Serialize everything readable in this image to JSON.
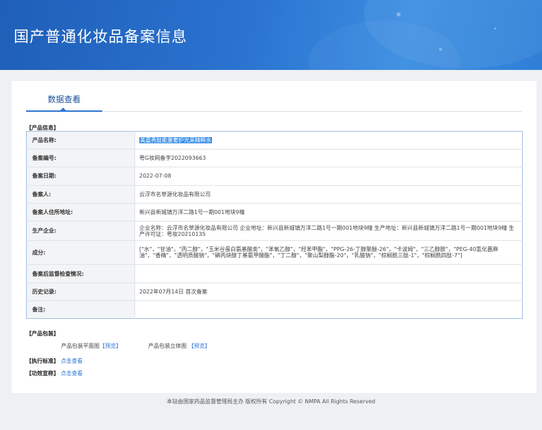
{
  "header": {
    "title": "国产普通化妆品备案信息"
  },
  "tabs": [
    {
      "label": "数据查看"
    }
  ],
  "product_info": {
    "section_label": "【产品信息】",
    "rows": [
      {
        "key": "产品名称:",
        "value": "美嘉秀肽能量奢护光采精粹水",
        "highlight": true
      },
      {
        "key": "备案编号:",
        "value": "粤G妆网备字2022093663"
      },
      {
        "key": "备案日期:",
        "value": "2022-07-08"
      },
      {
        "key": "备案人:",
        "value": "云浮市名草源化妆品有限公司"
      },
      {
        "key": "备案人住所地址:",
        "value": "新兴县新城镇万洋二路1号一期001地块9幢"
      },
      {
        "key": "生产企业:",
        "value": "企业名称：云浮市名草源化妆品有限公司 企业地址：新兴县新城镇万洋二路1号一期001地块9幢 生产地址：新兴县新城镇万洋二路1号一期001地块9幢 生产许可证：粤妆20210135"
      },
      {
        "key": "成分:",
        "value": "[\"水\"，\"甘油\"，\"丙二醇\"，\"玉米谷蛋白氨基酸类\"，\"苯氧乙醇\"，\"羟苯甲酯\"，\"PPG-26-丁醇聚醚-26\"，\"卡波姆\"，\"三乙醇胺\"，\"PEG-40氢化蓖麻油\"，\"香精\"，\"透明质酸钠\"，\"碘丙炔醇丁基氨甲酸酯\"，\"丁二醇\"，\"聚山梨醇酯-20\"，\"乳酸钠\"，\"棕榈酰三肽-1\"，\"棕榈酰四肽-7\"]"
      },
      {
        "key": "备案后监督检查情况:",
        "value": ""
      },
      {
        "key": "历史记录:",
        "value": "2022年07月14日 首次备案"
      },
      {
        "key": "备注:",
        "value": ""
      }
    ]
  },
  "packaging": {
    "section_label": "【产品包装】",
    "flat_label": "产品包装平面图",
    "flat_preview": "【预览】",
    "stereo_label": "产品包装立体图",
    "stereo_preview": "【预览】"
  },
  "standard": {
    "label": "【执行标准】",
    "link": "点击查看"
  },
  "efficacy": {
    "label": "【功效宣称】",
    "link": "点击查看"
  },
  "footer": {
    "text": "本站由国家药品监督管理局主办 版权所有 Copyright © NMPA All Rights Reserved"
  }
}
